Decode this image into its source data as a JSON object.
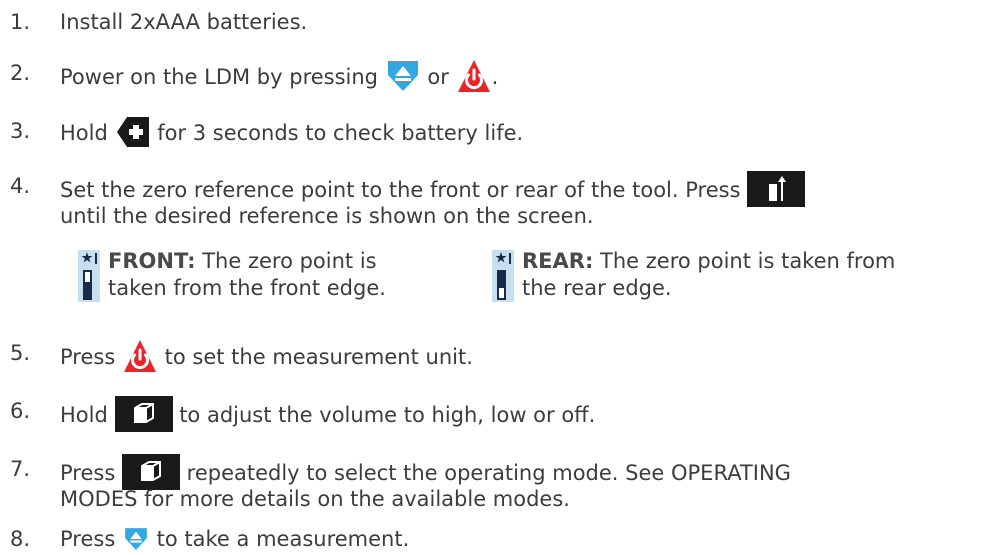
{
  "steps": [
    {
      "num": "1.",
      "text": "Install 2xAAA batteries."
    },
    {
      "num": "2.",
      "before": "Power on the LDM by pressing",
      "mid": "or",
      "after": "."
    },
    {
      "num": "3.",
      "before": "Hold",
      "after": "for 3 seconds to check battery life."
    },
    {
      "num": "4.",
      "before": "Set the zero reference point to the front or rear of the tool. Press",
      "line2": "until the desired reference is shown on the screen."
    },
    {
      "num": "5.",
      "before": "Press",
      "after": "to set the measurement unit."
    },
    {
      "num": "6.",
      "before": "Hold",
      "after": "to adjust the volume to high, low or off."
    },
    {
      "num": "7.",
      "before": "Press",
      "after": "repeatedly to select the operating mode. See OPERATING",
      "line2": "MODES for more details on the available modes."
    },
    {
      "num": "8.",
      "before": "Press",
      "after": "to take a measurement."
    }
  ],
  "references": {
    "front": {
      "label": "FRONT:",
      "line1": "The zero point is",
      "line2": "taken from the front edge."
    },
    "rear": {
      "label": "REAR:",
      "line1": "The zero point is taken from",
      "line2": "the rear edge."
    }
  },
  "icons": {
    "measure": "measure-triangle-icon",
    "power": "power-icon",
    "plus": "plus-key-icon",
    "reference": "reference-toggle-icon",
    "mode": "mode-cube-icon",
    "front_ref": "front-reference-icon",
    "rear_ref": "rear-reference-icon"
  },
  "colors": {
    "text": "#3c3c3c",
    "measure_blue": "#33a8e0",
    "power_red": "#e8262a",
    "key_black": "#1a1a1a"
  }
}
